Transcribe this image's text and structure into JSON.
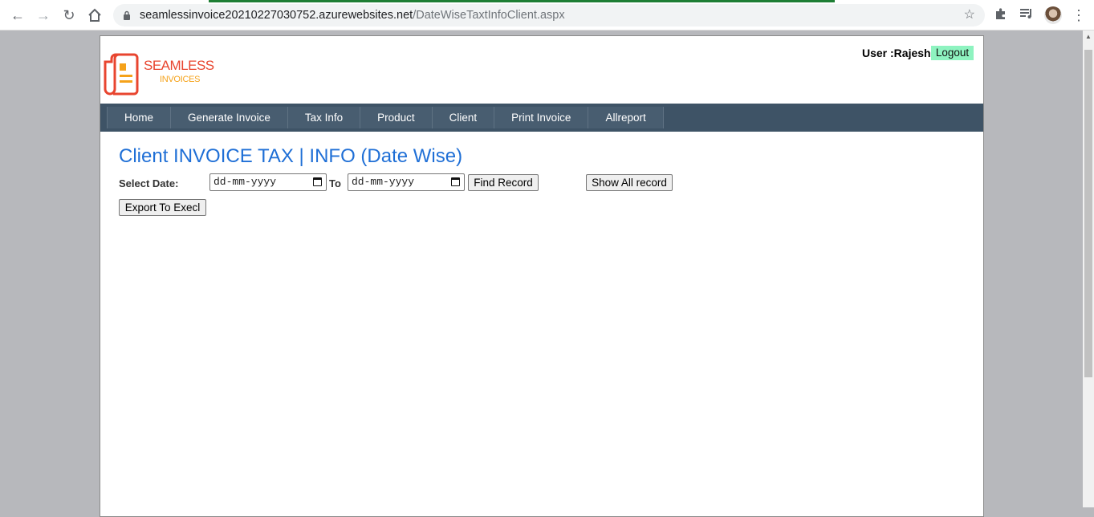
{
  "browser": {
    "url_host": "seamlessinvoice20210227030752.azurewebsites.net",
    "url_path": "/DateWiseTaxtInfoClient.aspx",
    "icons": {
      "back": "back-arrow-icon",
      "forward": "forward-arrow-icon",
      "reload": "reload-icon",
      "home": "home-icon",
      "lock": "lock-icon",
      "star": "bookmark-star-icon",
      "extensions": "puzzle-icon",
      "media": "media-queue-icon",
      "menu": "kebab-menu-icon"
    }
  },
  "header": {
    "logo_line1": "SEAMLESS",
    "logo_line2": "INVOICES",
    "user_label": "User :Rajesh",
    "logout_label": "Logout"
  },
  "menu": {
    "items": [
      {
        "label": "Home"
      },
      {
        "label": "Generate Invoice"
      },
      {
        "label": "Tax Info"
      },
      {
        "label": "Product"
      },
      {
        "label": "Client"
      },
      {
        "label": "Print Invoice"
      },
      {
        "label": "Allreport"
      }
    ]
  },
  "main": {
    "title": "Client INVOICE TAX | INFO (Date Wise)",
    "select_date_label": "Select Date:",
    "from_date": {
      "value": "dd-mm-yyyy"
    },
    "to_label": "To",
    "to_date": {
      "value": "dd-mm-yyyy"
    },
    "find_button": "Find Record",
    "show_all_button": "Show All record",
    "export_button": "Export To Execl"
  },
  "colors": {
    "menubar": "#3e5366",
    "title": "#1f6fd6",
    "logout_bg": "#8ef3c0",
    "page_bg": "#b7b8bc"
  }
}
